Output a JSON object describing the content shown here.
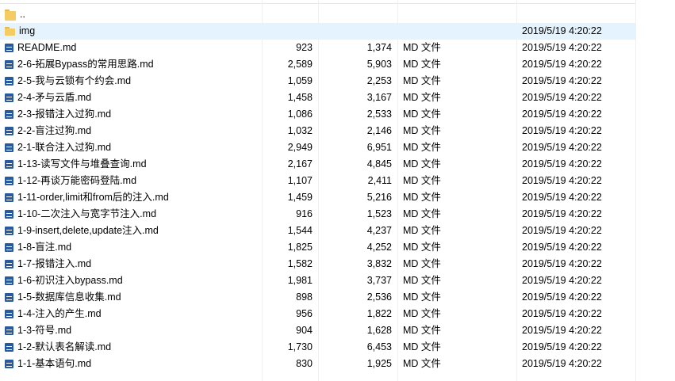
{
  "files": [
    {
      "name": "..",
      "icon": "folder-icon",
      "compressed": "",
      "size": "",
      "type": "",
      "modified": ""
    },
    {
      "name": "img",
      "icon": "folder-icon",
      "compressed": "",
      "size": "",
      "type": "",
      "modified": "2019/5/19 4:20:22",
      "selected": true
    },
    {
      "name": "README.md",
      "icon": "md-file-icon",
      "compressed": "923",
      "size": "1,374",
      "type": "MD 文件",
      "modified": "2019/5/19 4:20:22"
    },
    {
      "name": "2-6-拓展Bypass的常用思路.md",
      "icon": "md-file-icon",
      "compressed": "2,589",
      "size": "5,903",
      "type": "MD 文件",
      "modified": "2019/5/19 4:20:22"
    },
    {
      "name": "2-5-我与云锁有个约会.md",
      "icon": "md-file-icon",
      "compressed": "1,059",
      "size": "2,253",
      "type": "MD 文件",
      "modified": "2019/5/19 4:20:22"
    },
    {
      "name": "2-4-矛与云盾.md",
      "icon": "md-file-icon",
      "compressed": "1,458",
      "size": "3,167",
      "type": "MD 文件",
      "modified": "2019/5/19 4:20:22"
    },
    {
      "name": "2-3-报错注入过狗.md",
      "icon": "md-file-icon",
      "compressed": "1,086",
      "size": "2,533",
      "type": "MD 文件",
      "modified": "2019/5/19 4:20:22"
    },
    {
      "name": "2-2-盲注过狗.md",
      "icon": "md-file-icon",
      "compressed": "1,032",
      "size": "2,146",
      "type": "MD 文件",
      "modified": "2019/5/19 4:20:22"
    },
    {
      "name": "2-1-联合注入过狗.md",
      "icon": "md-file-icon",
      "compressed": "2,949",
      "size": "6,951",
      "type": "MD 文件",
      "modified": "2019/5/19 4:20:22"
    },
    {
      "name": "1-13-读写文件与堆叠查询.md",
      "icon": "md-file-icon",
      "compressed": "2,167",
      "size": "4,845",
      "type": "MD 文件",
      "modified": "2019/5/19 4:20:22"
    },
    {
      "name": "1-12-再谈万能密码登陆.md",
      "icon": "md-file-icon",
      "compressed": "1,107",
      "size": "2,411",
      "type": "MD 文件",
      "modified": "2019/5/19 4:20:22"
    },
    {
      "name": "1-11-order,limit和from后的注入.md",
      "icon": "md-file-icon",
      "compressed": "1,459",
      "size": "5,216",
      "type": "MD 文件",
      "modified": "2019/5/19 4:20:22"
    },
    {
      "name": "1-10-二次注入与宽字节注入.md",
      "icon": "md-file-icon",
      "compressed": "916",
      "size": "1,523",
      "type": "MD 文件",
      "modified": "2019/5/19 4:20:22"
    },
    {
      "name": "1-9-insert,delete,update注入.md",
      "icon": "md-file-icon",
      "compressed": "1,544",
      "size": "4,237",
      "type": "MD 文件",
      "modified": "2019/5/19 4:20:22"
    },
    {
      "name": "1-8-盲注.md",
      "icon": "md-file-icon",
      "compressed": "1,825",
      "size": "4,252",
      "type": "MD 文件",
      "modified": "2019/5/19 4:20:22"
    },
    {
      "name": "1-7-报错注入.md",
      "icon": "md-file-icon",
      "compressed": "1,582",
      "size": "3,832",
      "type": "MD 文件",
      "modified": "2019/5/19 4:20:22"
    },
    {
      "name": "1-6-初识注入bypass.md",
      "icon": "md-file-icon",
      "compressed": "1,981",
      "size": "3,737",
      "type": "MD 文件",
      "modified": "2019/5/19 4:20:22"
    },
    {
      "name": "1-5-数据库信息收集.md",
      "icon": "md-file-icon",
      "compressed": "898",
      "size": "2,536",
      "type": "MD 文件",
      "modified": "2019/5/19 4:20:22"
    },
    {
      "name": "1-4-注入的产生.md",
      "icon": "md-file-icon",
      "compressed": "956",
      "size": "1,822",
      "type": "MD 文件",
      "modified": "2019/5/19 4:20:22"
    },
    {
      "name": "1-3-符号.md",
      "icon": "md-file-icon",
      "compressed": "904",
      "size": "1,628",
      "type": "MD 文件",
      "modified": "2019/5/19 4:20:22"
    },
    {
      "name": "1-2-默认表名解读.md",
      "icon": "md-file-icon",
      "compressed": "1,730",
      "size": "6,453",
      "type": "MD 文件",
      "modified": "2019/5/19 4:20:22"
    },
    {
      "name": "1-1-基本语句.md",
      "icon": "md-file-icon",
      "compressed": "830",
      "size": "1,925",
      "type": "MD 文件",
      "modified": "2019/5/19 4:20:22"
    }
  ],
  "colors": {
    "selection": "#e5f3ff",
    "folder": "#f5cb63",
    "md_icon": "#2a5a9e"
  }
}
